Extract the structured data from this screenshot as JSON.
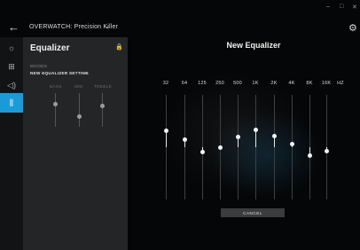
{
  "window": {
    "minimize_glyph": "–",
    "maximize_glyph": "□",
    "close_glyph": "✕"
  },
  "header": {
    "back_glyph": "←",
    "profile_name": "OVERWATCH: Precision Killer",
    "profile_chevron": "⌄",
    "settings_glyph": "⚙"
  },
  "rail": {
    "items": [
      {
        "name": "lighting-icon",
        "glyph": "☼"
      },
      {
        "name": "assignments-icon",
        "glyph": "⊞"
      },
      {
        "name": "speaker-icon",
        "glyph": "◁)"
      },
      {
        "name": "equalizer-icon",
        "glyph": "⫼"
      }
    ]
  },
  "panel": {
    "title": "Equalizer",
    "lock_glyph": "🔒",
    "moods_label": "MOODS",
    "moods_value": "NEW EQUALIZER SETTING",
    "moods_chevron": "⌄",
    "bands": [
      {
        "label": "BASS",
        "level": 0.32
      },
      {
        "label": "MID",
        "level": -0.4
      },
      {
        "label": "TREBLE",
        "level": 0.22
      }
    ]
  },
  "equalizer": {
    "title": "New Equalizer",
    "unit": "HZ",
    "bands": [
      {
        "freq": "32",
        "level": 0.32
      },
      {
        "freq": "64",
        "level": 0.14
      },
      {
        "freq": "125",
        "level": -0.1
      },
      {
        "freq": "250",
        "level": 0.0
      },
      {
        "freq": "500",
        "level": 0.2
      },
      {
        "freq": "1K",
        "level": 0.34
      },
      {
        "freq": "2K",
        "level": 0.22
      },
      {
        "freq": "4K",
        "level": 0.06
      },
      {
        "freq": "8K",
        "level": -0.16
      },
      {
        "freq": "16K",
        "level": -0.08
      }
    ],
    "cancel_label": "CANCEL"
  },
  "colors": {
    "accent": "#1a9bd7",
    "panel": "#242526",
    "background": "#050607"
  }
}
